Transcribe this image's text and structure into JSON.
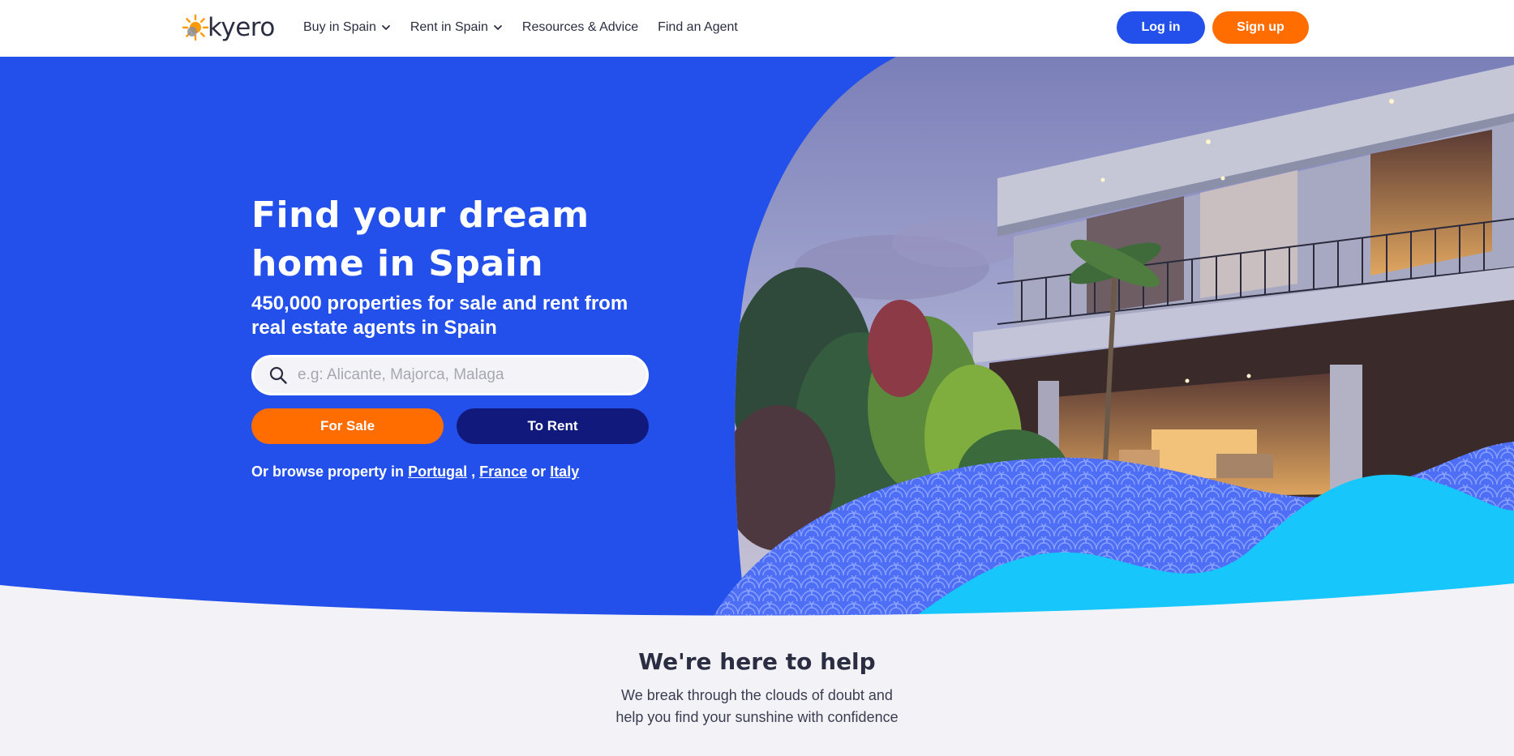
{
  "header": {
    "logo_text": "kyero",
    "nav": [
      {
        "label": "Buy in Spain",
        "dropdown": true
      },
      {
        "label": "Rent in Spain",
        "dropdown": true
      },
      {
        "label": "Resources & Advice",
        "dropdown": false
      },
      {
        "label": "Find an Agent",
        "dropdown": false
      }
    ],
    "login_label": "Log in",
    "signup_label": "Sign up"
  },
  "hero": {
    "title_line1": "Find your dream",
    "title_line2": "home in Spain",
    "subtitle": "450,000 properties for sale and rent from real estate agents in Spain",
    "search_placeholder": "e.g: Alicante, Majorca, Malaga",
    "search_value": "",
    "for_sale_label": "For Sale",
    "to_rent_label": "To Rent",
    "browse_prefix": "Or browse property in",
    "browse_links": [
      "Portugal",
      "France",
      "Italy"
    ],
    "browse_sep": ",",
    "browse_or": "or"
  },
  "help": {
    "title": "We're here to help",
    "line1": "We break through the clouds of doubt and",
    "line2": "help you find your sunshine with confidence"
  },
  "colors": {
    "brand_blue": "#2350eb",
    "brand_orange": "#ff6d00",
    "navy": "#111a7c",
    "cyan": "#17c7fb"
  },
  "icons": {
    "logo": "sun-icon",
    "nav_dropdown": "chevron-down-icon",
    "search": "search-icon"
  }
}
